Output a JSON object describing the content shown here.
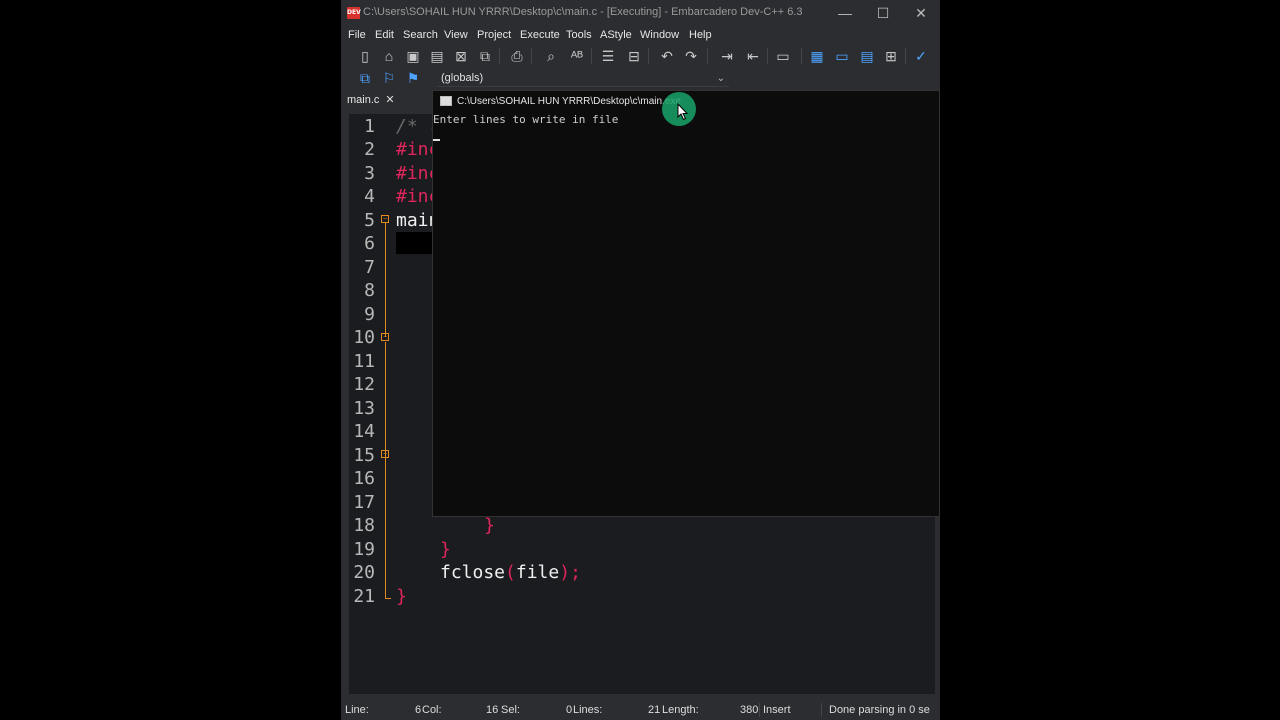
{
  "window": {
    "icon_text": "DEV",
    "title": "C:\\Users\\SOHAIL HUN YRRR\\Desktop\\c\\main.c - [Executing] - Embarcadero Dev-C++ 6.3",
    "minimize": "—",
    "maximize": "☐",
    "close": "✕"
  },
  "menu": [
    "File",
    "Edit",
    "Search",
    "View",
    "Project",
    "Execute",
    "Tools",
    "AStyle",
    "Window",
    "Help"
  ],
  "scope_selector": {
    "value": "(globals)"
  },
  "tab": {
    "label": "main.c",
    "close": "✕"
  },
  "line_numbers": [
    "1",
    "2",
    "3",
    "4",
    "5",
    "6",
    "7",
    "8",
    "9",
    "10",
    "11",
    "12",
    "13",
    "14",
    "15",
    "16",
    "17",
    "18",
    "19",
    "20",
    "21"
  ],
  "code_fragments": {
    "l1": "/* (",
    "l2": "#inc",
    "l3": "#inc",
    "l4": "#inc",
    "l5": "main",
    "l18": "}",
    "l19": "}",
    "l20_a": "fclose",
    "l20_b": "(",
    "l20_c": "file",
    "l20_d": ")",
    "l20_e": ";",
    "l21": "}"
  },
  "console": {
    "title": "C:\\Users\\SOHAIL HUN YRRR\\Desktop\\c\\main.exe",
    "output": "Enter lines to write in file"
  },
  "status": {
    "line_label": "Line:",
    "line_value": "6",
    "col_label": "Col:",
    "col_value": "16",
    "sel_label": "Sel:",
    "sel_value": "0",
    "lines_label": "Lines:",
    "lines_value": "21",
    "length_label": "Length:",
    "length_value": "380",
    "mode": "Insert",
    "message": "Done parsing in 0 se"
  },
  "colors": {
    "accent": "#e0265c",
    "fold": "#e08a1e",
    "cursor_highlight": "#1aa36a"
  }
}
